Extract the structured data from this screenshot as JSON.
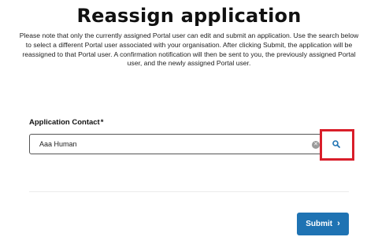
{
  "page": {
    "title": "Reassign application",
    "intro": "Please note that only the currently assigned Portal user can edit and submit an application. Use the search below to select a different Portal user associated with your organisation. After clicking Submit, the application will be reassigned to that Portal user. A confirmation notification will then be sent to you, the previously assigned Portal user, and the newly assigned Portal user."
  },
  "form": {
    "contact_label": "Application Contact",
    "required_marker": "*",
    "contact_value": "Aaa Human",
    "clear_icon": "clear-icon",
    "search_icon": "search-icon"
  },
  "actions": {
    "submit_label": "Submit",
    "submit_icon": "chevron-right-icon"
  },
  "colors": {
    "primary": "#1f73b3",
    "highlight": "#d91e2a"
  }
}
